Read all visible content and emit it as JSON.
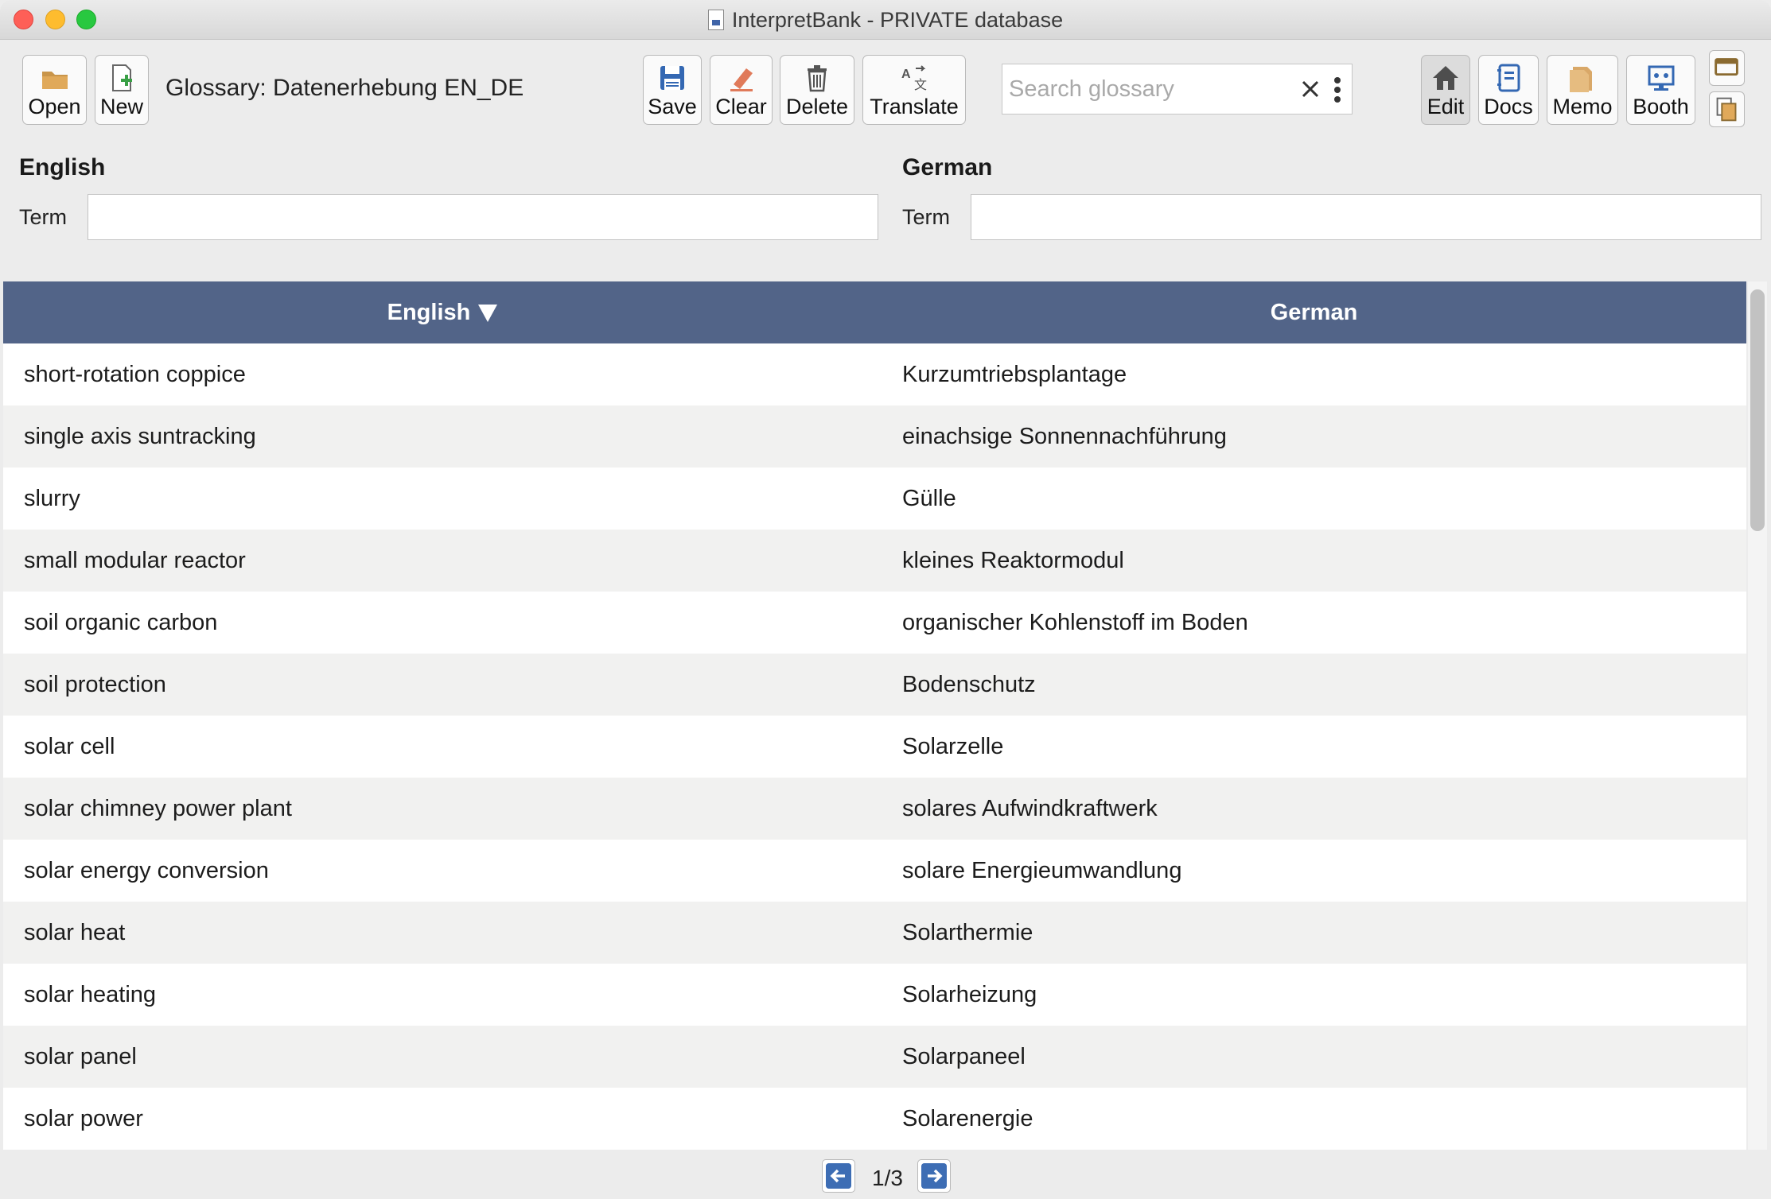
{
  "window": {
    "title": "InterpretBank - PRIVATE database"
  },
  "toolbar": {
    "open_label": "Open",
    "new_label": "New",
    "glossary_label": "Glossary: Datenerhebung EN_DE",
    "save_label": "Save",
    "clear_label": "Clear",
    "delete_label": "Delete",
    "translate_label": "Translate",
    "edit_label": "Edit",
    "docs_label": "Docs",
    "memo_label": "Memo",
    "booth_label": "Booth"
  },
  "search": {
    "placeholder": "Search glossary",
    "value": ""
  },
  "form": {
    "english_header": "English",
    "german_header": "German",
    "english_term_label": "Term",
    "german_term_label": "Term",
    "english_term_value": "",
    "german_term_value": ""
  },
  "table": {
    "columns": [
      "English",
      "German"
    ],
    "sort_column": "English",
    "sort_direction": "descending-indicator",
    "rows": [
      {
        "en": "short-rotation coppice",
        "de": "Kurzumtriebsplantage"
      },
      {
        "en": "single axis suntracking",
        "de": "einachsige Sonnennachführung"
      },
      {
        "en": "slurry",
        "de": "Gülle"
      },
      {
        "en": "small modular reactor",
        "de": "kleines Reaktormodul"
      },
      {
        "en": "soil organic carbon",
        "de": "organischer Kohlenstoff im Boden"
      },
      {
        "en": "soil protection",
        "de": "Bodenschutz"
      },
      {
        "en": "solar cell",
        "de": "Solarzelle"
      },
      {
        "en": "solar chimney power plant",
        "de": "solares Aufwindkraftwerk"
      },
      {
        "en": "solar energy conversion",
        "de": "solare Energieumwandlung"
      },
      {
        "en": "solar heat",
        "de": "Solarthermie"
      },
      {
        "en": "solar heating",
        "de": "Solarheizung"
      },
      {
        "en": "solar panel",
        "de": "Solarpaneel"
      },
      {
        "en": "solar power",
        "de": "Solarenergie"
      }
    ]
  },
  "pager": {
    "text": "1/3"
  },
  "colors": {
    "header_bg": "#526488",
    "row_alt": "#f1f1f0",
    "accent_blue": "#3d6db4"
  },
  "icons": [
    "document-icon",
    "folder-icon",
    "new-file-icon",
    "floppy-icon",
    "eraser-icon",
    "trash-icon",
    "translate-icon",
    "close-x-icon",
    "kebab-icon",
    "home-icon",
    "notebook-icon",
    "memo-icon",
    "booth-icon",
    "window-icon",
    "copy-icon",
    "arrow-left-icon",
    "arrow-right-icon"
  ]
}
